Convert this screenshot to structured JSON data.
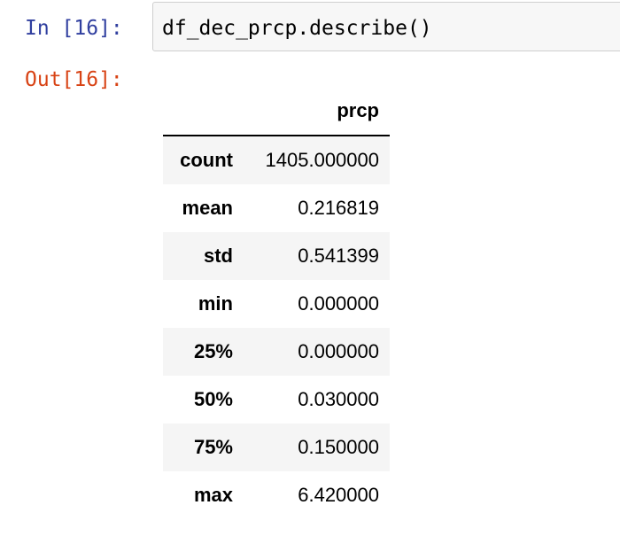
{
  "cell": {
    "in_prompt": "In [16]:",
    "code": "df_dec_prcp.describe()",
    "out_prompt": "Out[16]:"
  },
  "output_table": {
    "index_header": "",
    "columns": [
      "prcp"
    ],
    "rows": [
      {
        "label": "count",
        "value": "1405.000000"
      },
      {
        "label": "mean",
        "value": "0.216819"
      },
      {
        "label": "std",
        "value": "0.541399"
      },
      {
        "label": "min",
        "value": "0.000000"
      },
      {
        "label": "25%",
        "value": "0.000000"
      },
      {
        "label": "50%",
        "value": "0.030000"
      },
      {
        "label": "75%",
        "value": "0.150000"
      },
      {
        "label": "max",
        "value": "6.420000"
      }
    ]
  },
  "colors": {
    "in_prompt": "#303f9f",
    "out_prompt": "#d84315",
    "input_background": "#f7f7f7",
    "input_border": "#cfcfcf",
    "row_stripe": "#f5f5f5"
  }
}
